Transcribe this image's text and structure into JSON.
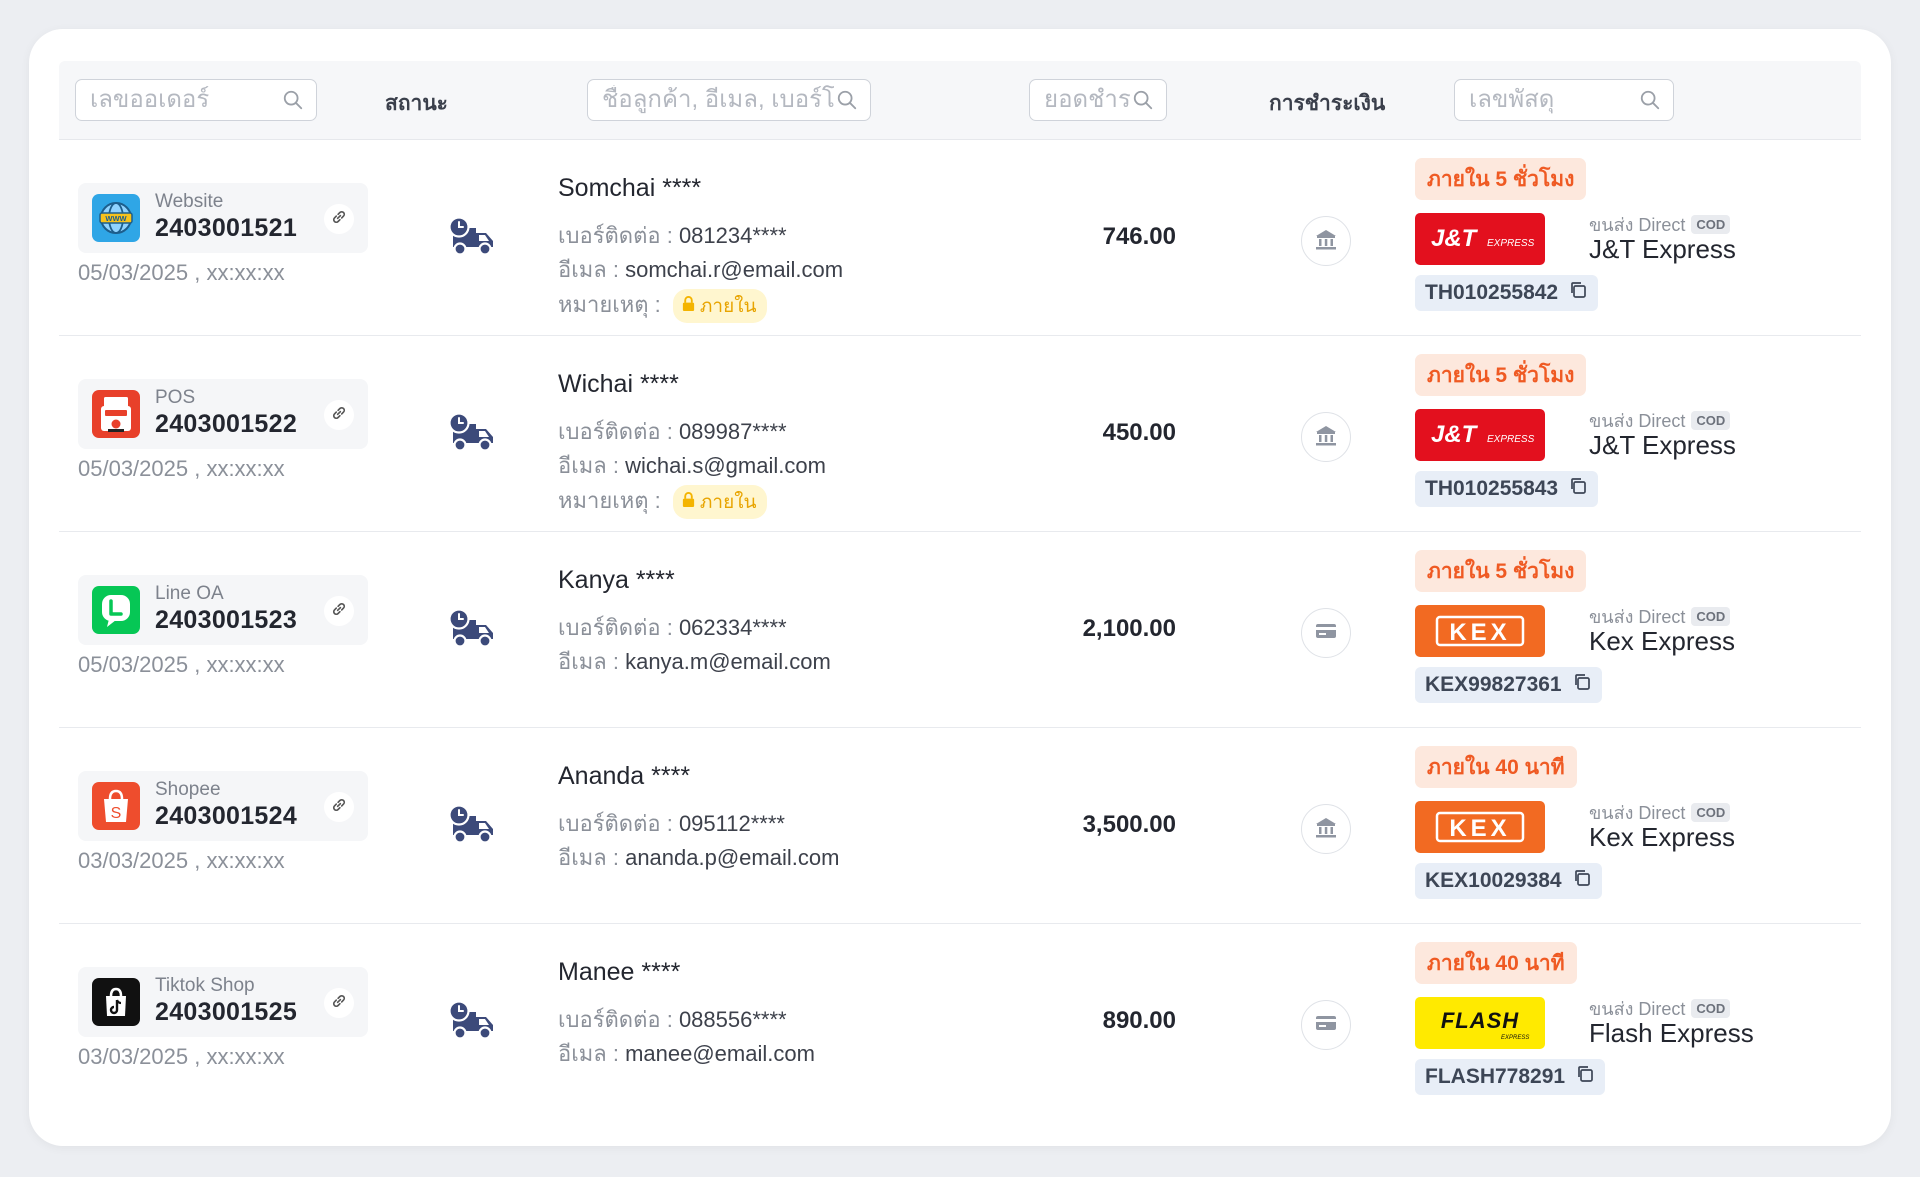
{
  "filters": {
    "order_placeholder": "เลขออเดอร์",
    "status_label": "สถานะ",
    "customer_placeholder": "ชื่อลูกค้า, อีเมล, เบอร์โทร",
    "amount_placeholder": "ยอดชำระ",
    "payment_label": "การชำระเงิน",
    "tracking_placeholder": "เลขพัสดุ"
  },
  "labels": {
    "phone": "เบอร์ติดต่อ :",
    "email": "อีเมล :",
    "note": "หมายเหตุ :",
    "via_prefix": "ขนส่ง Direct",
    "cod": "COD"
  },
  "orders": [
    {
      "channel": "Website",
      "channel_icon": "website-icon",
      "order_no": "2403001521",
      "date": "05/03/2025 , xx:xx:xx",
      "status_icon": "delivery-truck-icon",
      "customer": "Somchai ****",
      "phone": "081234****",
      "email": "somchai.r@email.com",
      "note": "ภายใน",
      "amount": "746.00",
      "payment_icon": "bank-icon",
      "sla": "ภายใน 5 ชั่วโมง",
      "carrier": "J&T Express",
      "carrier_logo": "jt-express-logo",
      "tracking": "TH010255842"
    },
    {
      "channel": "POS",
      "channel_icon": "pos-icon",
      "order_no": "2403001522",
      "date": "05/03/2025 , xx:xx:xx",
      "status_icon": "delivery-truck-icon",
      "customer": "Wichai ****",
      "phone": "089987****",
      "email": "wichai.s@gmail.com",
      "note": "ภายใน",
      "amount": "450.00",
      "payment_icon": "bank-icon",
      "sla": "ภายใน 5 ชั่วโมง",
      "carrier": "J&T Express",
      "carrier_logo": "jt-express-logo",
      "tracking": "TH010255843"
    },
    {
      "channel": "Line OA",
      "channel_icon": "line-icon",
      "order_no": "2403001523",
      "date": "05/03/2025 , xx:xx:xx",
      "status_icon": "delivery-truck-icon",
      "customer": "Kanya ****",
      "phone": "062334****",
      "email": "kanya.m@email.com",
      "note": null,
      "amount": "2,100.00",
      "payment_icon": "credit-card-icon",
      "sla": "ภายใน 5 ชั่วโมง",
      "carrier": "Kex Express",
      "carrier_logo": "kex-logo",
      "tracking": "KEX99827361"
    },
    {
      "channel": "Shopee",
      "channel_icon": "shopee-icon",
      "order_no": "2403001524",
      "date": "03/03/2025 , xx:xx:xx",
      "status_icon": "delivery-truck-icon",
      "customer": "Ananda ****",
      "phone": "095112****",
      "email": "ananda.p@email.com",
      "note": null,
      "amount": "3,500.00",
      "payment_icon": "bank-icon",
      "sla": "ภายใน 40 นาที",
      "carrier": "Kex Express",
      "carrier_logo": "kex-logo",
      "tracking": "KEX10029384"
    },
    {
      "channel": "Tiktok Shop",
      "channel_icon": "tiktok-icon",
      "order_no": "2403001525",
      "date": "03/03/2025 , xx:xx:xx",
      "status_icon": "delivery-truck-icon",
      "customer": "Manee ****",
      "phone": "088556****",
      "email": "manee@email.com",
      "note": null,
      "amount": "890.00",
      "payment_icon": "credit-card-icon",
      "sla": "ภายใน 40 นาที",
      "carrier": "Flash Express",
      "carrier_logo": "flash-express-logo",
      "tracking": "FLASH778291"
    }
  ],
  "colors": {
    "accent_orange": "#ef5a23",
    "sla_bg": "#fde8dd",
    "jt_red": "#e3101e",
    "kex_orange": "#f26a22",
    "flash_yellow": "#ffea00",
    "line_green": "#06c755",
    "shopee_orange": "#ee4d2d",
    "truck_navy": "#3c4a7a"
  }
}
